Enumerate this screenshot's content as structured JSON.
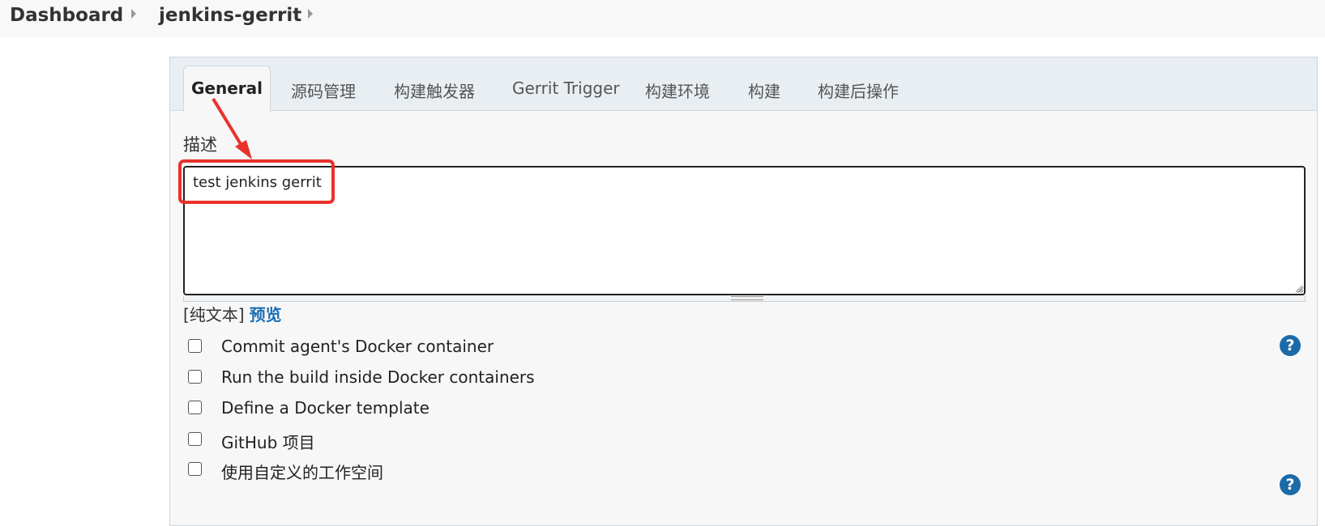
{
  "breadcrumb": {
    "items": [
      "Dashboard",
      "jenkins-gerrit"
    ]
  },
  "tabs": [
    {
      "label": "General",
      "active": true
    },
    {
      "label": "源码管理"
    },
    {
      "label": "构建触发器"
    },
    {
      "label": "Gerrit Trigger"
    },
    {
      "label": "构建环境"
    },
    {
      "label": "构建"
    },
    {
      "label": "构建后操作"
    }
  ],
  "description": {
    "label": "描述",
    "value": "test jenkins gerrit"
  },
  "format": {
    "plain_text": "[纯文本]",
    "preview": "预览"
  },
  "options": [
    {
      "label": "Commit agent's Docker container",
      "checked": false,
      "help_icon": true
    },
    {
      "label": "Run the build inside Docker containers",
      "checked": false
    },
    {
      "label": "Define a Docker template",
      "checked": false
    },
    {
      "label": "GitHub 项目",
      "checked": false
    },
    {
      "label": "使用自定义的工作空间",
      "checked": false,
      "help_icon": true
    }
  ],
  "help_glyph": "?",
  "colors": {
    "link": "#1a6fb5",
    "help_icon_bg": "#1c6aa8",
    "annotation": "#e8322b"
  }
}
